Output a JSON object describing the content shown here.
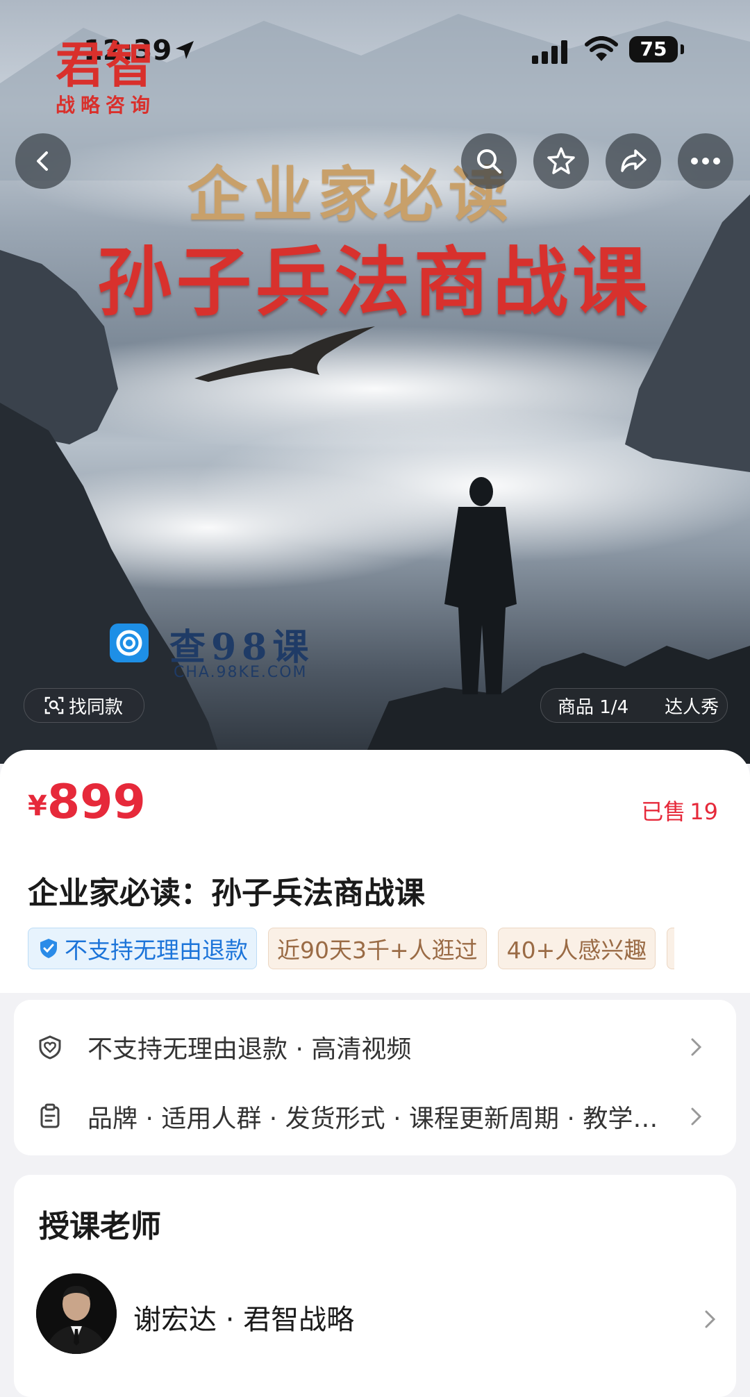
{
  "status_bar": {
    "time": "12:39",
    "battery": "75"
  },
  "poster": {
    "logo_main": "君智",
    "logo_sub": "战略咨询",
    "title_line1": "企业家必读",
    "title_line2": "孙子兵法商战课",
    "watermark_text": "查98课",
    "watermark_url": "CHA.98KE.COM"
  },
  "top_icons": [
    "back-icon",
    "search-icon",
    "star-icon",
    "share-icon",
    "more-icon"
  ],
  "hero_bottom": {
    "find_similar": "找同款",
    "gallery_counter": "商品 1/4",
    "influencer_show": "达人秀"
  },
  "product": {
    "currency": "¥",
    "price": "899",
    "sold_label": "已售",
    "sold_count": "19",
    "title": "企业家必读：孙子兵法商战课"
  },
  "tags": [
    {
      "label": "不支持无理由退款",
      "style": "blue"
    },
    {
      "label": "近90天3千+人逛过",
      "style": "beige"
    },
    {
      "label": "40+人感兴趣",
      "style": "beige"
    }
  ],
  "info_rows": [
    {
      "icon": "shield-heart-icon",
      "text": "不支持无理由退款 · 高清视频"
    },
    {
      "icon": "clipboard-icon",
      "text": "品牌 · 适用人群 · 发货形式 · 课程更新周期 · 教学…"
    }
  ],
  "teacher_section": {
    "heading": "授课老师",
    "name": "谢宏达 · 君智战略"
  },
  "colors": {
    "price_red": "#e6293a",
    "brand_red": "#d9302c",
    "tag_blue": "#1c74d9",
    "tag_beige": "#9a6b45"
  }
}
